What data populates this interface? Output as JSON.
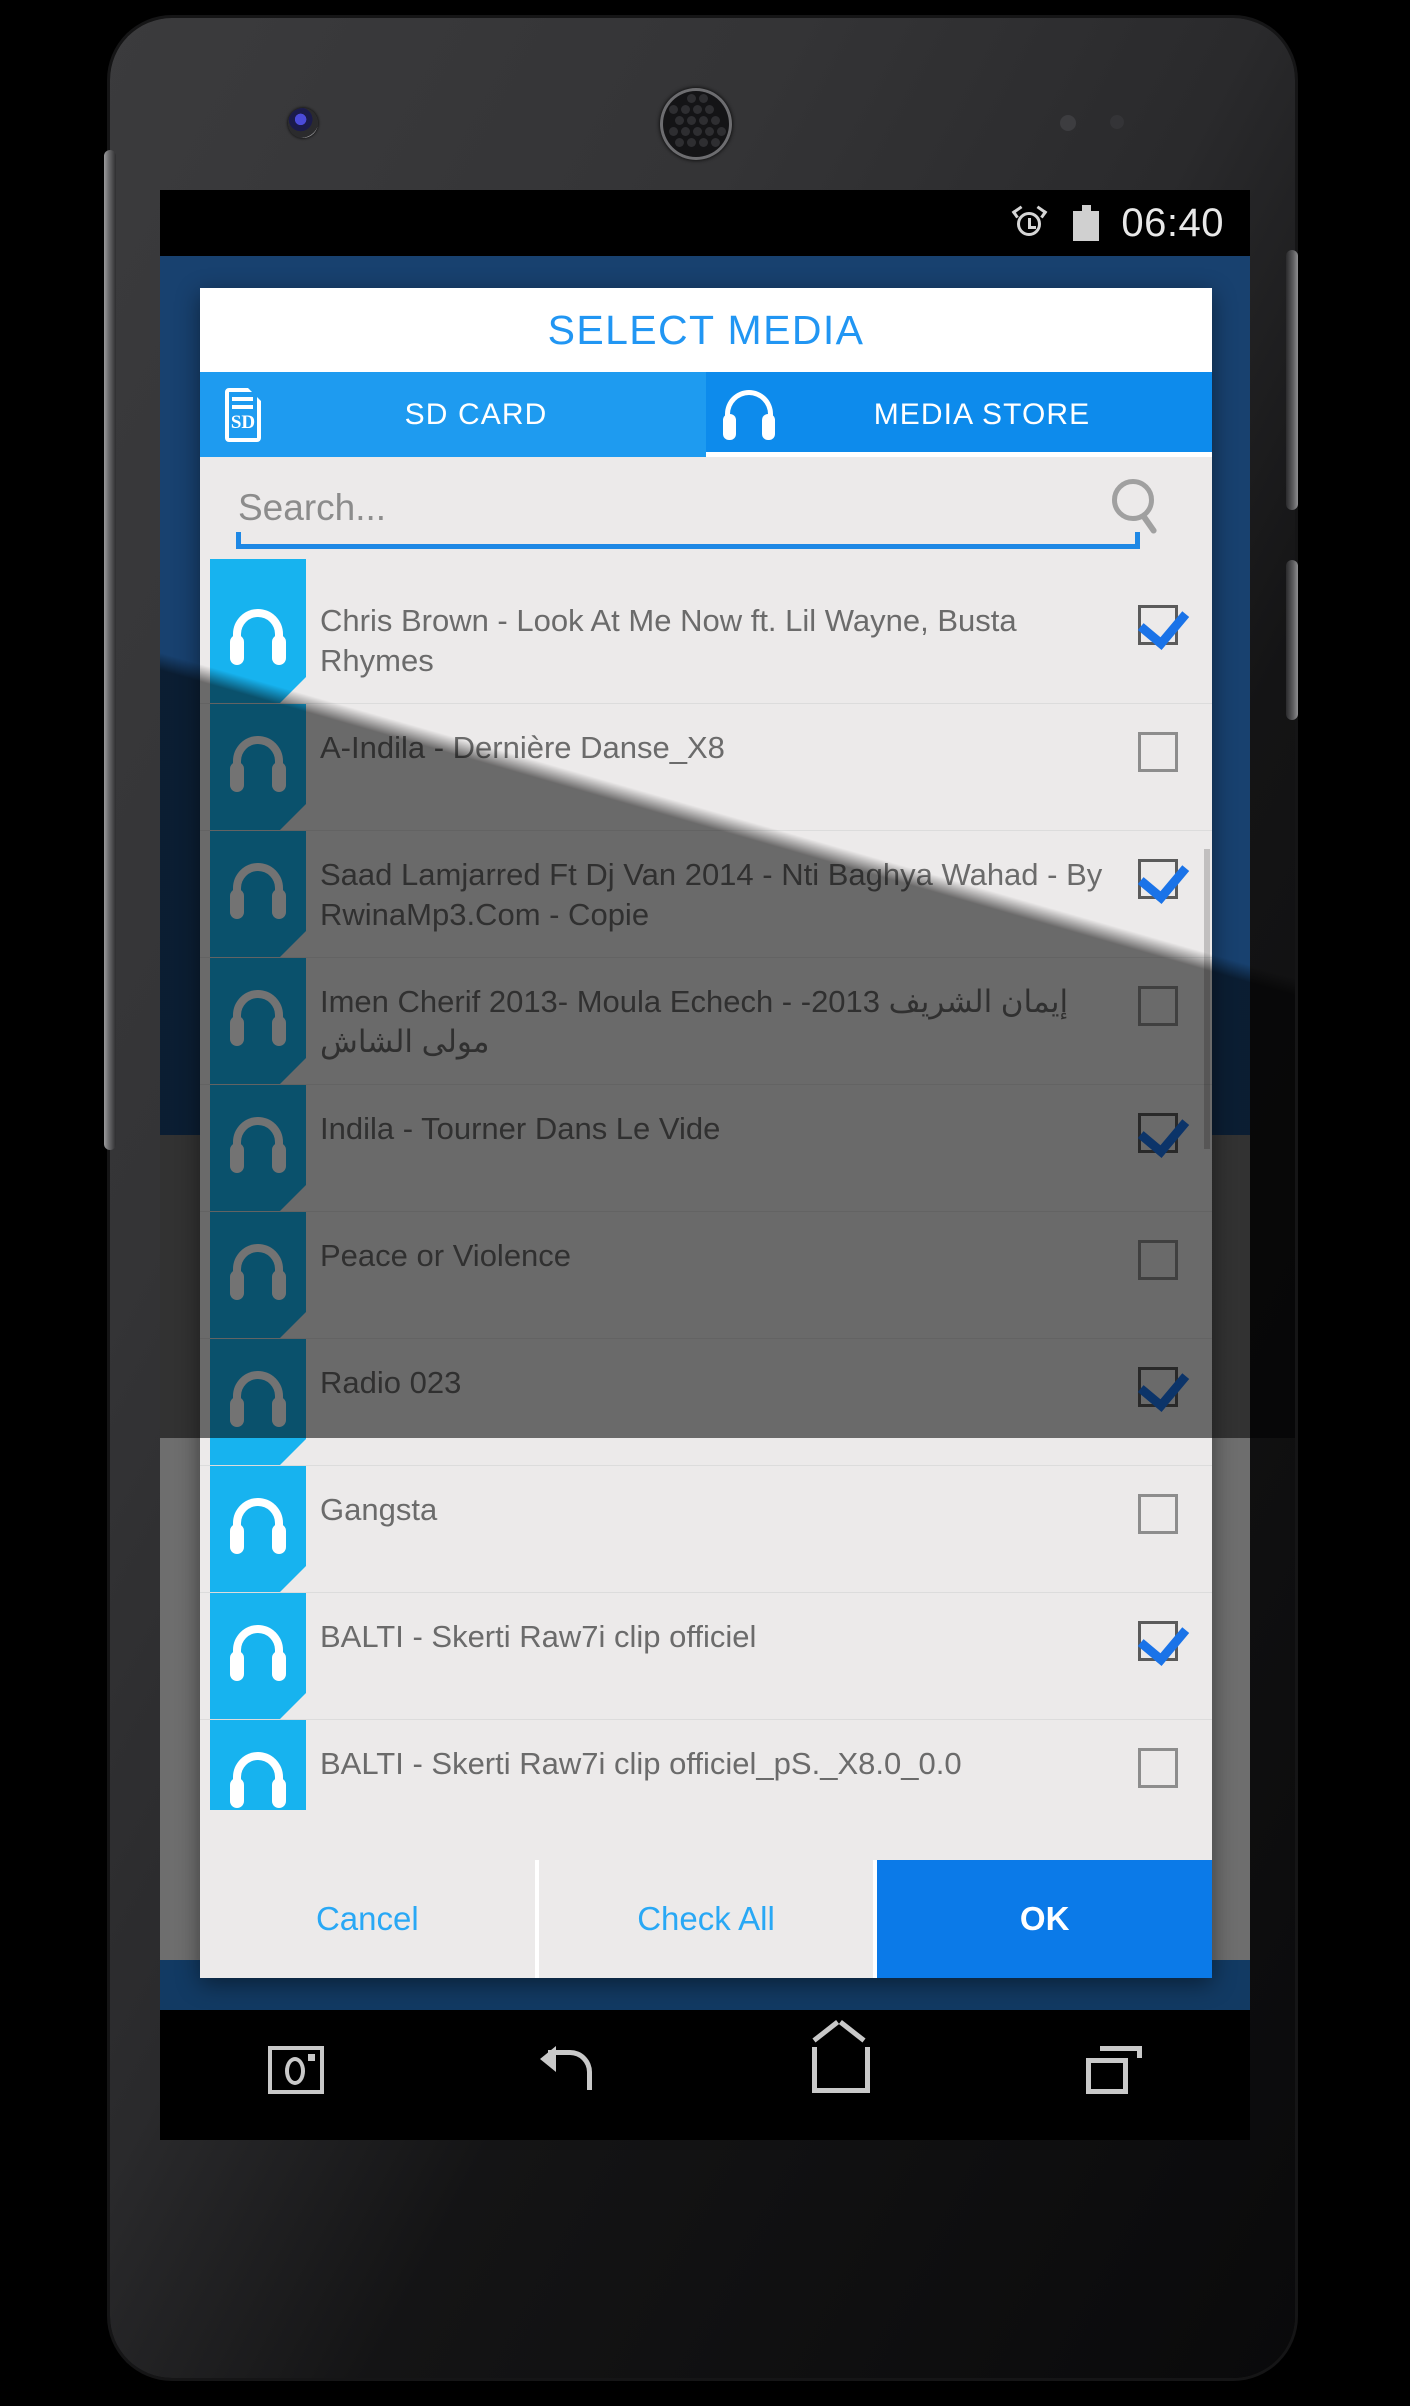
{
  "status_bar": {
    "alarm_icon": "alarm-clock-icon",
    "battery_icon": "battery-full-icon",
    "time": "06:40"
  },
  "dialog": {
    "title": "SELECT MEDIA",
    "tabs": [
      {
        "label": "SD CARD",
        "icon": "sd-card-icon",
        "active": false
      },
      {
        "label": "MEDIA STORE",
        "icon": "headphones-icon",
        "active": true
      }
    ],
    "search": {
      "placeholder": "Search...",
      "value": "",
      "icon": "search-icon"
    },
    "list": [
      {
        "title": "Chris Brown - Look At Me Now ft. Lil Wayne, Busta Rhymes",
        "checked": true
      },
      {
        "title": "A-Indila - Dernière Danse_X8",
        "checked": false
      },
      {
        "title": "Saad Lamjarred Ft Dj Van 2014 - Nti Baghya Wahad - By RwinaMp3.Com - Copie",
        "checked": true
      },
      {
        "title": "Imen Cherif 2013- Moula Echech - إيمان الشريف 2013- مولى الشاش",
        "checked": false
      },
      {
        "title": "Indila - Tourner Dans Le Vide",
        "checked": true
      },
      {
        "title": "Peace or Violence",
        "checked": false
      },
      {
        "title": "Radio 023",
        "checked": true
      },
      {
        "title": "Gangsta",
        "checked": false
      },
      {
        "title": "BALTI - Skerti Raw7i clip officiel",
        "checked": true
      },
      {
        "title": "BALTI - Skerti Raw7i clip officiel_pS._X8.0_0.0",
        "checked": false
      }
    ],
    "buttons": {
      "cancel": "Cancel",
      "check_all": "Check All",
      "ok": "OK"
    }
  },
  "nav_bar": {
    "items": [
      {
        "icon": "camera-screenshot-icon"
      },
      {
        "icon": "back-icon"
      },
      {
        "icon": "home-icon"
      },
      {
        "icon": "recent-apps-icon"
      }
    ]
  },
  "colors": {
    "accent_blue": "#1e9bf0",
    "title_blue": "#2196f3",
    "tag_blue": "#17b3ef",
    "ok_blue": "#0b7ae8",
    "app_background": "#18416f",
    "dialog_background": "#eceaea"
  }
}
